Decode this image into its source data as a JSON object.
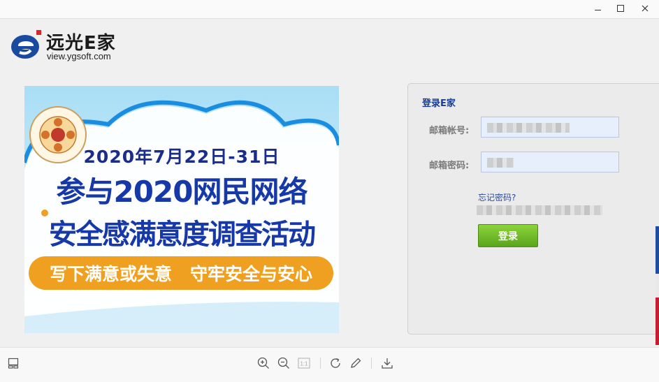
{
  "window": {
    "controls": {
      "minimize_icon": "minimize-icon",
      "maximize_icon": "maximize-icon",
      "close_icon": "close-icon"
    }
  },
  "logo": {
    "brand_name": "远光E家",
    "url": "view.ygsoft.com",
    "colors": {
      "e_blue": "#1a4aa0",
      "e_red": "#d8262b"
    }
  },
  "banner": {
    "date_line": "2020年7月22日-31日",
    "headline_1": "参与2020网民网络",
    "headline_2": "安全感满意度调查活动",
    "slogan": "写下满意或失意   守牢安全与安心"
  },
  "login": {
    "title": "登录E家",
    "email_label": "邮箱帐号:",
    "password_label": "邮箱密码:",
    "forgot_link": "忘记密码?",
    "submit_label": "登录",
    "accent_color": "#6ab42a"
  },
  "toolbar": {
    "icons": [
      "layout-icon",
      "zoom-in-icon",
      "zoom-out-icon",
      "actual-size-icon",
      "rotate-icon",
      "edit-icon",
      "download-icon"
    ],
    "actual_size_text": "1:1"
  }
}
